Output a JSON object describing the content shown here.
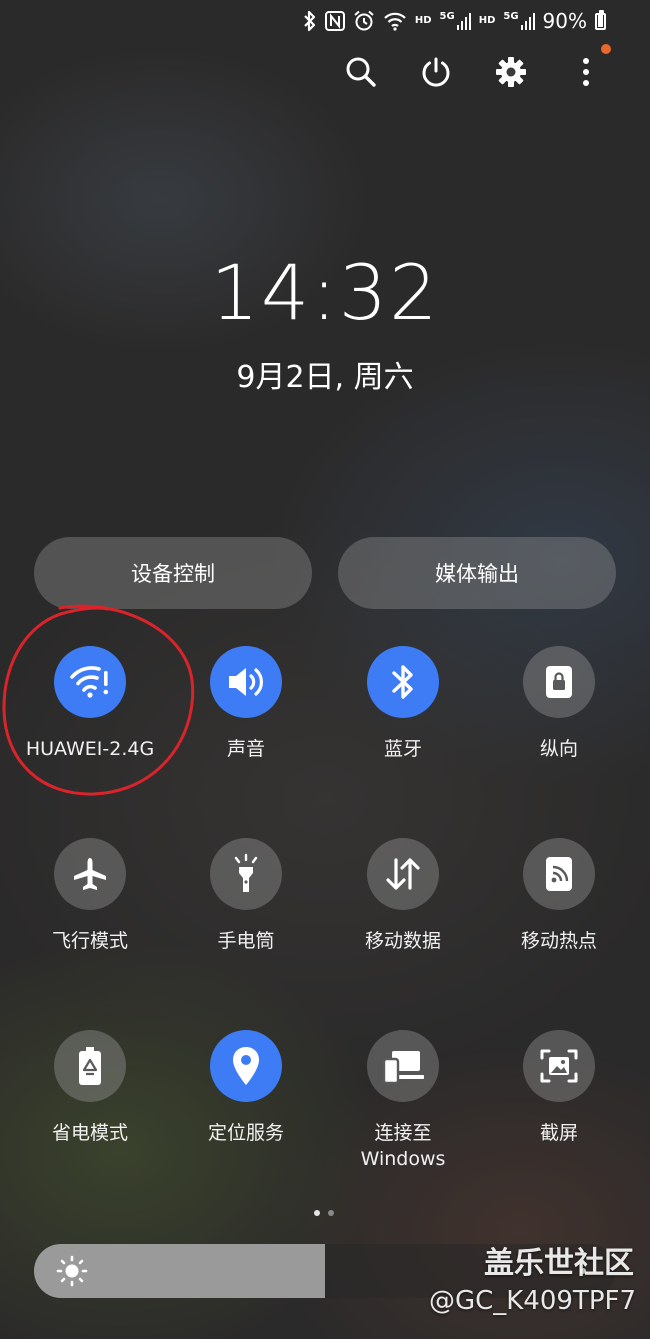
{
  "status_bar": {
    "icons": [
      "bluetooth-icon",
      "nfc-icon",
      "alarm-icon",
      "wifi-icon",
      "hd-icon",
      "5g-signal-icon",
      "hd-icon",
      "5g-signal-icon"
    ],
    "hd1": "HD",
    "net1": "5G",
    "hd2": "HD",
    "net2": "5G",
    "battery_percent": "90%",
    "battery_level": 0.9
  },
  "top_actions": [
    "search-icon",
    "power-icon",
    "settings-icon",
    "more-vert-icon"
  ],
  "clock": {
    "time": "14:32",
    "date": "9月2日, 周六"
  },
  "shortcuts": {
    "device_control": "设备控制",
    "media_output": "媒体输出"
  },
  "tiles": [
    {
      "name": "wifi",
      "label": "HUAWEI-2.4G",
      "icon": "wifi-alert-icon",
      "active": true
    },
    {
      "name": "sound",
      "label": "声音",
      "icon": "volume-icon",
      "active": true
    },
    {
      "name": "bluetooth",
      "label": "蓝牙",
      "icon": "bluetooth-icon",
      "active": true
    },
    {
      "name": "portrait",
      "label": "纵向",
      "icon": "rotation-lock-icon",
      "active": false
    },
    {
      "name": "airplane",
      "label": "飞行模式",
      "icon": "airplane-icon",
      "active": false
    },
    {
      "name": "flashlight",
      "label": "手电筒",
      "icon": "flashlight-icon",
      "active": false
    },
    {
      "name": "mobile-data",
      "label": "移动数据",
      "icon": "data-arrows-icon",
      "active": false
    },
    {
      "name": "hotspot",
      "label": "移动热点",
      "icon": "hotspot-icon",
      "active": false
    },
    {
      "name": "power-saving",
      "label": "省电模式",
      "icon": "battery-saver-icon",
      "active": false
    },
    {
      "name": "location",
      "label": "定位服务",
      "icon": "location-pin-icon",
      "active": true
    },
    {
      "name": "link-windows",
      "label": "连接至\nWindows",
      "icon": "link-windows-icon",
      "active": false
    },
    {
      "name": "screenshot",
      "label": "截屏",
      "icon": "screenshot-icon",
      "active": false
    }
  ],
  "pager": {
    "pages": 2,
    "current": 1
  },
  "brightness": {
    "level": 0.5,
    "icon": "sun-icon"
  },
  "watermark": {
    "line1": "盖乐世社区",
    "line2": "@GC_K409TPF7"
  },
  "colors": {
    "accent": "#3e7cf5",
    "annotation": "#d8242a",
    "notification_dot": "#e8672c"
  }
}
